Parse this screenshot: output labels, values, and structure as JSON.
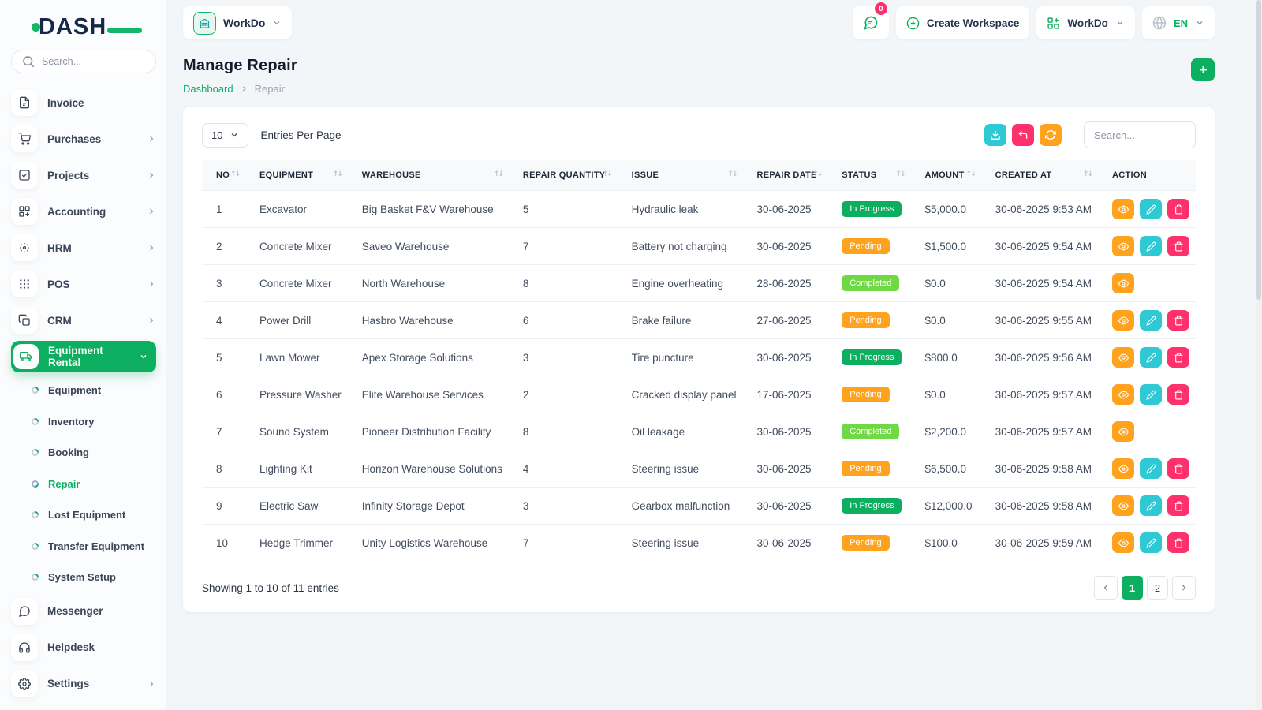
{
  "brand": {
    "name": "DASH"
  },
  "sidebar": {
    "search_placeholder": "Search...",
    "items": [
      {
        "label": "Invoice"
      },
      {
        "label": "Purchases"
      },
      {
        "label": "Projects"
      },
      {
        "label": "Accounting"
      },
      {
        "label": "HRM"
      },
      {
        "label": "POS"
      },
      {
        "label": "CRM"
      },
      {
        "label": "Equipment Rental"
      },
      {
        "label": "Messenger"
      },
      {
        "label": "Helpdesk"
      },
      {
        "label": "Settings"
      }
    ],
    "equipment_rental_children": [
      {
        "label": "Equipment",
        "active": false
      },
      {
        "label": "Inventory",
        "active": false
      },
      {
        "label": "Booking",
        "active": false
      },
      {
        "label": "Repair",
        "active": true
      },
      {
        "label": "Lost Equipment",
        "active": false
      },
      {
        "label": "Transfer Equipment",
        "active": false
      },
      {
        "label": "System Setup",
        "active": false
      }
    ]
  },
  "header": {
    "workspace_name": "WorkDo",
    "messages_badge": "0",
    "create_workspace_label": "Create Workspace",
    "workdo_menu_label": "WorkDo",
    "language": "EN"
  },
  "page": {
    "title": "Manage Repair",
    "breadcrumb_root": "Dashboard",
    "breadcrumb_current": "Repair"
  },
  "table": {
    "entries_per_page": "10",
    "entries_label": "Entries Per Page",
    "search_placeholder": "Search...",
    "columns": [
      {
        "label": "NO",
        "sortable": true
      },
      {
        "label": "EQUIPMENT",
        "sortable": true
      },
      {
        "label": "WAREHOUSE",
        "sortable": true
      },
      {
        "label": "REPAIR QUANTITY",
        "sortable": true
      },
      {
        "label": "ISSUE",
        "sortable": true
      },
      {
        "label": "REPAIR DATE",
        "sortable": true
      },
      {
        "label": "STATUS",
        "sortable": true
      },
      {
        "label": "AMOUNT",
        "sortable": true
      },
      {
        "label": "CREATED AT",
        "sortable": true
      },
      {
        "label": "ACTION",
        "sortable": false
      }
    ],
    "rows": [
      {
        "no": "1",
        "equipment": "Excavator",
        "warehouse": "Big Basket F&V Warehouse",
        "quantity": "5",
        "issue": "Hydraulic leak",
        "repair_date": "30-06-2025",
        "status": "In Progress",
        "status_type": "in-progress",
        "amount": "$5,000.0",
        "created_at": "30-06-2025 9:53 AM",
        "actions": [
          "view",
          "edit",
          "delete"
        ]
      },
      {
        "no": "2",
        "equipment": "Concrete Mixer",
        "warehouse": "Saveo Warehouse",
        "quantity": "7",
        "issue": "Battery not charging",
        "repair_date": "30-06-2025",
        "status": "Pending",
        "status_type": "pending",
        "amount": "$1,500.0",
        "created_at": "30-06-2025 9:54 AM",
        "actions": [
          "view",
          "edit",
          "delete"
        ]
      },
      {
        "no": "3",
        "equipment": "Concrete Mixer",
        "warehouse": "North Warehouse",
        "quantity": "8",
        "issue": "Engine overheating",
        "repair_date": "28-06-2025",
        "status": "Completed",
        "status_type": "completed",
        "amount": "$0.0",
        "created_at": "30-06-2025 9:54 AM",
        "actions": [
          "view"
        ]
      },
      {
        "no": "4",
        "equipment": "Power Drill",
        "warehouse": "Hasbro Warehouse",
        "quantity": "6",
        "issue": "Brake failure",
        "repair_date": "27-06-2025",
        "status": "Pending",
        "status_type": "pending",
        "amount": "$0.0",
        "created_at": "30-06-2025 9:55 AM",
        "actions": [
          "view",
          "edit",
          "delete"
        ]
      },
      {
        "no": "5",
        "equipment": "Lawn Mower",
        "warehouse": "Apex Storage Solutions",
        "quantity": "3",
        "issue": "Tire puncture",
        "repair_date": "30-06-2025",
        "status": "In Progress",
        "status_type": "in-progress",
        "amount": "$800.0",
        "created_at": "30-06-2025 9:56 AM",
        "actions": [
          "view",
          "edit",
          "delete"
        ]
      },
      {
        "no": "6",
        "equipment": "Pressure Washer",
        "warehouse": "Elite Warehouse Services",
        "quantity": "2",
        "issue": "Cracked display panel",
        "repair_date": "17-06-2025",
        "status": "Pending",
        "status_type": "pending",
        "amount": "$0.0",
        "created_at": "30-06-2025 9:57 AM",
        "actions": [
          "view",
          "edit",
          "delete"
        ]
      },
      {
        "no": "7",
        "equipment": "Sound System",
        "warehouse": "Pioneer Distribution Facility",
        "quantity": "8",
        "issue": "Oil leakage",
        "repair_date": "30-06-2025",
        "status": "Completed",
        "status_type": "completed",
        "amount": "$2,200.0",
        "created_at": "30-06-2025 9:57 AM",
        "actions": [
          "view"
        ]
      },
      {
        "no": "8",
        "equipment": "Lighting Kit",
        "warehouse": "Horizon Warehouse Solutions",
        "quantity": "4",
        "issue": "Steering issue",
        "repair_date": "30-06-2025",
        "status": "Pending",
        "status_type": "pending",
        "amount": "$6,500.0",
        "created_at": "30-06-2025 9:58 AM",
        "actions": [
          "view",
          "edit",
          "delete"
        ]
      },
      {
        "no": "9",
        "equipment": "Electric Saw",
        "warehouse": "Infinity Storage Depot",
        "quantity": "3",
        "issue": "Gearbox malfunction",
        "repair_date": "30-06-2025",
        "status": "In Progress",
        "status_type": "in-progress",
        "amount": "$12,000.0",
        "created_at": "30-06-2025 9:58 AM",
        "actions": [
          "view",
          "edit",
          "delete"
        ]
      },
      {
        "no": "10",
        "equipment": "Hedge Trimmer",
        "warehouse": "Unity Logistics Warehouse",
        "quantity": "7",
        "issue": "Steering issue",
        "repair_date": "30-06-2025",
        "status": "Pending",
        "status_type": "pending",
        "amount": "$100.0",
        "created_at": "30-06-2025 9:59 AM",
        "actions": [
          "view",
          "edit",
          "delete"
        ]
      }
    ],
    "footer_summary": "Showing 1 to 10 of 11 entries",
    "pages": [
      "1",
      "2"
    ],
    "active_page": "1"
  },
  "colors": {
    "primary": "#0caf60",
    "success_light": "#6fd943",
    "warning": "#ffa21d",
    "info": "#2fc9d4",
    "danger": "#ff316c"
  }
}
